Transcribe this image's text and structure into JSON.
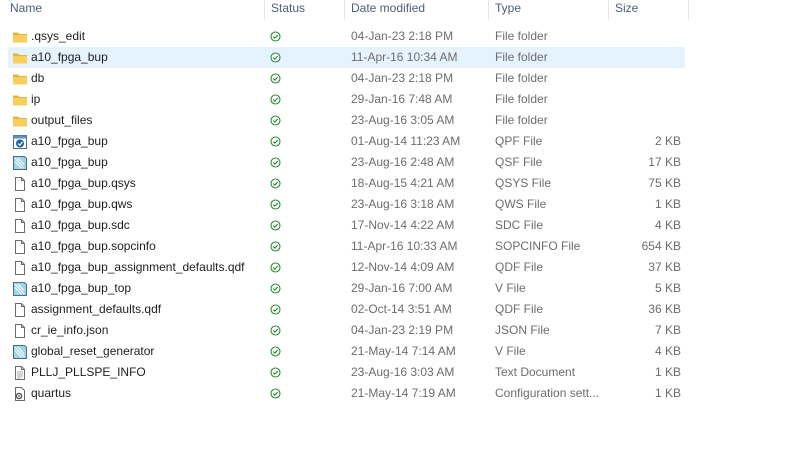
{
  "columns": {
    "name": "Name",
    "status": "Status",
    "date_modified": "Date modified",
    "type": "Type",
    "size": "Size"
  },
  "files": [
    {
      "name": ".qsys_edit",
      "date": "04-Jan-23 2:18 PM",
      "type": "File folder",
      "size": "",
      "icon": "folder-icon"
    },
    {
      "name": "a10_fpga_bup",
      "date": "11-Apr-16 10:34 AM",
      "type": "File folder",
      "size": "",
      "icon": "folder-icon",
      "selected": true
    },
    {
      "name": "db",
      "date": "04-Jan-23 2:18 PM",
      "type": "File folder",
      "size": "",
      "icon": "folder-icon"
    },
    {
      "name": "ip",
      "date": "29-Jan-16 7:48 AM",
      "type": "File folder",
      "size": "",
      "icon": "folder-icon"
    },
    {
      "name": "output_files",
      "date": "23-Aug-16 3:05 AM",
      "type": "File folder",
      "size": "",
      "icon": "folder-icon"
    },
    {
      "name": "a10_fpga_bup",
      "date": "01-Aug-14 11:23 AM",
      "type": "QPF File",
      "size": "2 KB",
      "icon": "quartus-project-icon"
    },
    {
      "name": "a10_fpga_bup",
      "date": "23-Aug-16 2:48 AM",
      "type": "QSF File",
      "size": "17 KB",
      "icon": "verilog-file-icon"
    },
    {
      "name": "a10_fpga_bup.qsys",
      "date": "18-Aug-15 4:21 AM",
      "type": "QSYS File",
      "size": "75 KB",
      "icon": "blank-file-icon"
    },
    {
      "name": "a10_fpga_bup.qws",
      "date": "23-Aug-16 3:18 AM",
      "type": "QWS File",
      "size": "1 KB",
      "icon": "blank-file-icon"
    },
    {
      "name": "a10_fpga_bup.sdc",
      "date": "17-Nov-14 4:22 AM",
      "type": "SDC File",
      "size": "4 KB",
      "icon": "blank-file-icon"
    },
    {
      "name": "a10_fpga_bup.sopcinfo",
      "date": "11-Apr-16 10:33 AM",
      "type": "SOPCINFO File",
      "size": "654 KB",
      "icon": "blank-file-icon"
    },
    {
      "name": "a10_fpga_bup_assignment_defaults.qdf",
      "date": "12-Nov-14 4:09 AM",
      "type": "QDF File",
      "size": "37 KB",
      "icon": "blank-file-icon"
    },
    {
      "name": "a10_fpga_bup_top",
      "date": "29-Jan-16 7:00 AM",
      "type": "V File",
      "size": "5 KB",
      "icon": "verilog-file-icon"
    },
    {
      "name": "assignment_defaults.qdf",
      "date": "02-Oct-14 3:51 AM",
      "type": "QDF File",
      "size": "36 KB",
      "icon": "blank-file-icon"
    },
    {
      "name": "cr_ie_info.json",
      "date": "04-Jan-23 2:19 PM",
      "type": "JSON File",
      "size": "7 KB",
      "icon": "blank-file-icon"
    },
    {
      "name": "global_reset_generator",
      "date": "21-May-14 7:14 AM",
      "type": "V File",
      "size": "4 KB",
      "icon": "verilog-file-icon"
    },
    {
      "name": "PLLJ_PLLSPE_INFO",
      "date": "23-Aug-16 3:03 AM",
      "type": "Text Document",
      "size": "1 KB",
      "icon": "text-document-icon"
    },
    {
      "name": "quartus",
      "date": "21-May-14 7:19 AM",
      "type": "Configuration sett...",
      "size": "1 KB",
      "icon": "config-file-icon"
    }
  ],
  "colors": {
    "selected_row": "#e5f3ff",
    "header_text": "#4c607a",
    "status_ok": "#2e8b3a",
    "folder": "#f0c44c"
  }
}
